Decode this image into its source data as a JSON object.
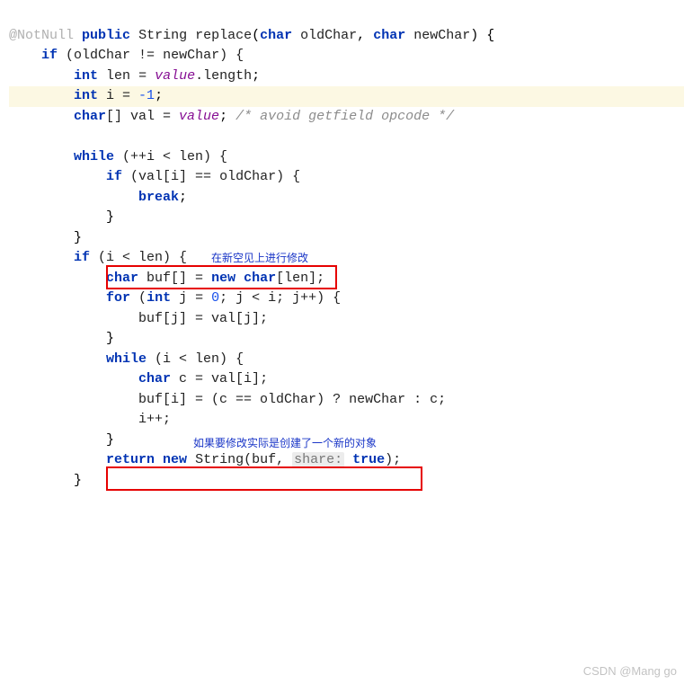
{
  "code": {
    "annotation": "@NotNull",
    "sig_public": "public",
    "sig_ret": "String",
    "sig_name": "replace",
    "sig_p1type": "char",
    "sig_p1name": "oldChar",
    "sig_p2type": "char",
    "sig_p2name": "newChar",
    "if1": "if",
    "if1_cond": "(oldChar != newChar) {",
    "int_kw": "int",
    "len_name": "len",
    "len_assign": " = ",
    "value_ident": "value",
    "length_ident": ".length",
    "i_decl_prefix": " i = ",
    "i_init": "-1",
    "char_kw": "char",
    "val_decl": "[] val = ",
    "comment1": "/* avoid getfield opcode */",
    "while_kw": "while",
    "while1_cond": " (++i < len) {",
    "if2_cond": " (val[i] == oldChar) {",
    "break_kw": "break",
    "if3_cond": " (i < len) {",
    "buf_decl": " buf[] = ",
    "new_kw": "new",
    "buf_type": " char",
    "buf_len": "[len];",
    "for_kw": "for",
    "for_open": " (",
    "for_jdecl": " j = ",
    "for_jinit": "0",
    "for_cond": "; j < i; j++) {",
    "for_body": "buf[j] = val[j];",
    "while2_cond": " (i < len) {",
    "c_decl": " c = val[i];",
    "buf_assign": "buf[i] = (c == oldChar) ? newChar : c;",
    "ipp": "i++;",
    "return_kw": "return",
    "ret_new": " new",
    "ret_type": " String(buf, ",
    "hint_share": "share:",
    "ret_true": " true",
    "ret_close": ");"
  },
  "notes": {
    "top": "在新空见上进行修改",
    "bottom": "如果要修改实际是创建了一个新的对象"
  },
  "watermark": "CSDN @Mang go"
}
